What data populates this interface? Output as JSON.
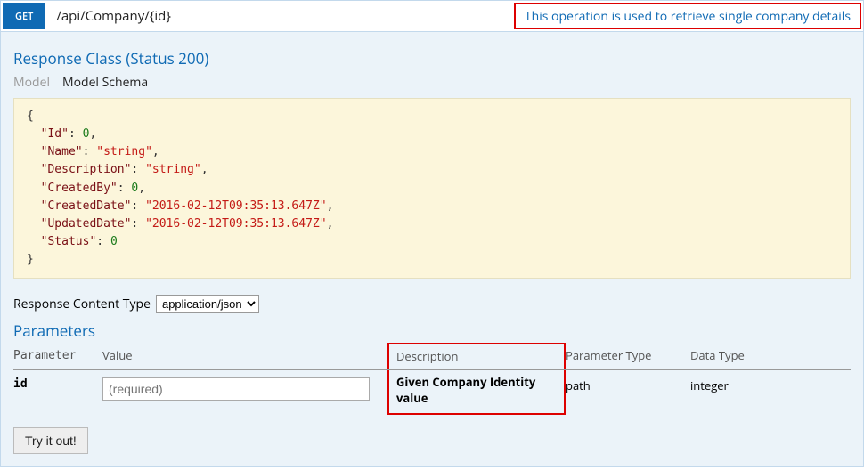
{
  "op": {
    "method": "GET",
    "path": "/api/Company/{id}",
    "summary": "This operation is used to retrieve single company details"
  },
  "response": {
    "title": "Response Class (Status 200)",
    "tabs": {
      "model": "Model",
      "schema": "Model Schema"
    },
    "schema": {
      "fields": [
        {
          "key": "Id",
          "value": "0",
          "type": "num"
        },
        {
          "key": "Name",
          "value": "\"string\"",
          "type": "str"
        },
        {
          "key": "Description",
          "value": "\"string\"",
          "type": "str"
        },
        {
          "key": "CreatedBy",
          "value": "0",
          "type": "num"
        },
        {
          "key": "CreatedDate",
          "value": "\"2016-02-12T09:35:13.647Z\"",
          "type": "str"
        },
        {
          "key": "UpdatedDate",
          "value": "\"2016-02-12T09:35:13.647Z\"",
          "type": "str"
        },
        {
          "key": "Status",
          "value": "0",
          "type": "num"
        }
      ]
    }
  },
  "contentType": {
    "label": "Response Content Type",
    "selected": "application/json"
  },
  "parameters": {
    "title": "Parameters",
    "headers": {
      "param": "Parameter",
      "value": "Value",
      "desc": "Description",
      "ptype": "Parameter Type",
      "dtype": "Data Type"
    },
    "rows": [
      {
        "name": "id",
        "placeholder": "(required)",
        "description": "Given Company Identity value",
        "paramType": "path",
        "dataType": "integer"
      }
    ]
  },
  "tryit": "Try it out!"
}
